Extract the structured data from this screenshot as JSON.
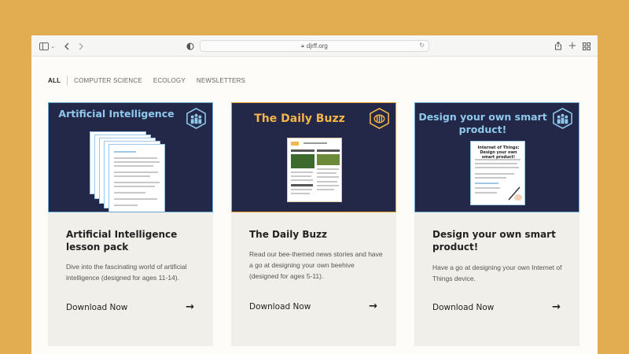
{
  "browser": {
    "url": "djrff.org",
    "sidebar_icon": "sidebar-icon",
    "back_icon": "chevron-left-icon",
    "forward_icon": "chevron-right-icon",
    "privacy_icon": "shield-icon",
    "share_icon": "share-icon",
    "new_tab_icon": "plus-icon",
    "tabs_icon": "grid-icon"
  },
  "filters": [
    {
      "label": "ALL",
      "active": true
    },
    {
      "label": "COMPUTER SCIENCE",
      "active": false
    },
    {
      "label": "ECOLOGY",
      "active": false
    },
    {
      "label": "NEWSLETTERS",
      "active": false
    }
  ],
  "cards": [
    {
      "banner_title": "Artificial Intelligence",
      "title": "Artificial Intelligence lesson pack",
      "description": "Dive into the fascinating world of artificial intelligence (designed for ages 11-14).",
      "cta": "Download Now",
      "icon": "hexagon-people-icon"
    },
    {
      "banner_title": "The Daily Buzz",
      "title": "The Daily Buzz",
      "description": "Read our bee-themed news stories and have a go at designing your own beehive (designed for ages 5-11).",
      "cta": "Download Now",
      "icon": "hexagon-bee-icon"
    },
    {
      "banner_title": "Design your own smart product!",
      "title": "Design your own smart product!",
      "description": "Have a go at designing your own Internet of Things device.",
      "cta": "Download Now",
      "icon": "hexagon-people-icon",
      "preview_title": "Internet of Things: Design your own smart product!"
    }
  ],
  "colors": {
    "page_bg": "#e2ac50",
    "banner_bg": "#242848",
    "banner_title_blue": "#8fc8ea",
    "banner_title_orange": "#f4b54a",
    "card_bg": "#f0efe9"
  }
}
